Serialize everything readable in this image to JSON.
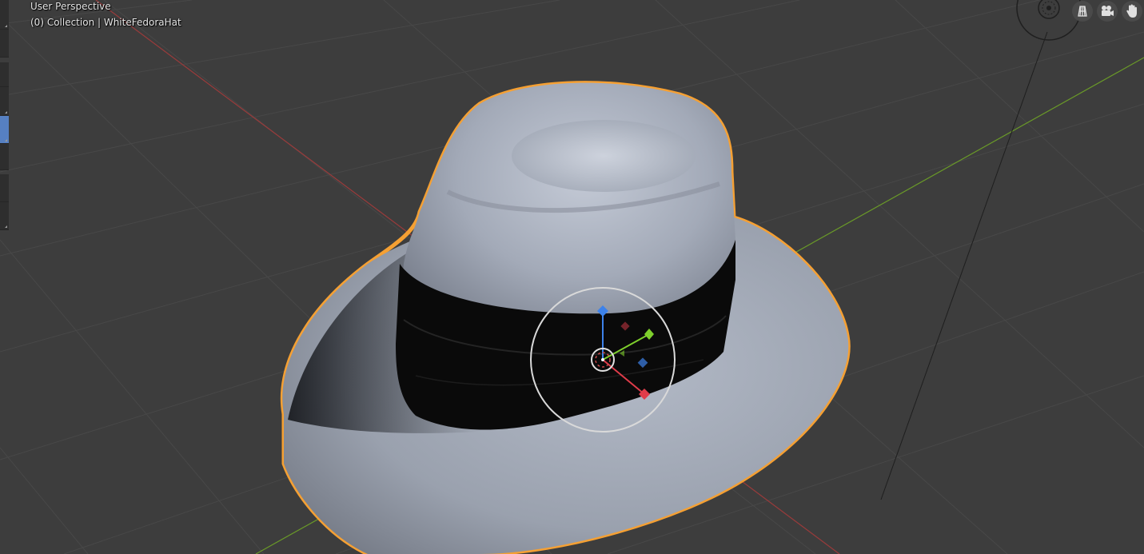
{
  "viewport": {
    "view_name": "User Perspective",
    "object_info": "(0) Collection | WhiteFedoraHat",
    "selection_outline_color": "#f5a033",
    "x_axis_color": "#9a3b3b",
    "y_axis_color": "#6a9a28",
    "grid_color": "#4a4a4a",
    "hat_color": "#a9b0be",
    "band_color": "#0a0a0a"
  },
  "navigation": {
    "buttons": [
      {
        "name": "grid-view-icon"
      },
      {
        "name": "camera-icon"
      },
      {
        "name": "hand-pan-icon"
      }
    ]
  },
  "gizmo": {
    "z_color": "#3d82ea",
    "y_color": "#7ecf2c",
    "x_color": "#e03c4a"
  }
}
